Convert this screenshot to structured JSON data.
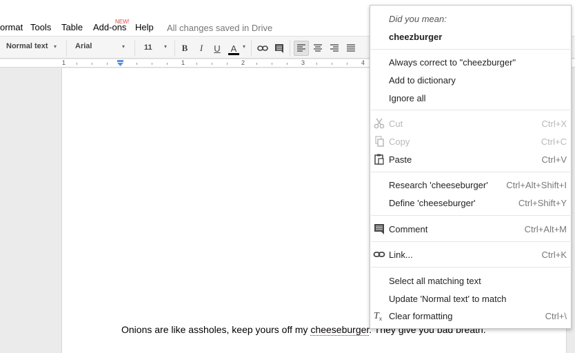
{
  "menubar": {
    "items": [
      "ormat",
      "Tools",
      "Table",
      "Add-ons",
      "Help"
    ],
    "new_badge": "NEW!",
    "status": "All changes saved in Drive"
  },
  "toolbar": {
    "style_select": "Normal text",
    "font_select": "Arial",
    "size_select": "11",
    "bold": "B",
    "italic": "I",
    "underline": "U",
    "text_color": "A",
    "icons": [
      "link-icon",
      "comment-icon",
      "align-left-icon",
      "align-center-icon",
      "align-right-icon",
      "align-justify-icon"
    ],
    "text_color_value": "#000000"
  },
  "ruler": {
    "numbers": [
      "1",
      "1",
      "2",
      "3",
      "4"
    ]
  },
  "document": {
    "before": "Onions are like assholes, keep yours off my ",
    "misspelled": "cheeseburger",
    "after": ". They give you bad breath."
  },
  "context_menu": {
    "did_you_mean": "Did you mean:",
    "suggestion": "cheezburger",
    "items": [
      {
        "label": "Always correct to \"cheezburger\"",
        "shortcut": "",
        "icon": ""
      },
      {
        "label": "Add to dictionary",
        "shortcut": "",
        "icon": ""
      },
      {
        "label": "Ignore all",
        "shortcut": "",
        "icon": ""
      },
      {
        "label": "Cut",
        "shortcut": "Ctrl+X",
        "icon": "scissors-icon",
        "disabled": true
      },
      {
        "label": "Copy",
        "shortcut": "Ctrl+C",
        "icon": "copy-icon",
        "disabled": true
      },
      {
        "label": "Paste",
        "shortcut": "Ctrl+V",
        "icon": "paste-icon"
      },
      {
        "label": "Research 'cheeseburger'",
        "shortcut": "Ctrl+Alt+Shift+I",
        "icon": ""
      },
      {
        "label": "Define 'cheeseburger'",
        "shortcut": "Ctrl+Shift+Y",
        "icon": ""
      },
      {
        "label": "Comment",
        "shortcut": "Ctrl+Alt+M",
        "icon": "comment-icon"
      },
      {
        "label": "Link...",
        "shortcut": "Ctrl+K",
        "icon": "link-icon"
      },
      {
        "label": "Select all matching text",
        "shortcut": "",
        "icon": ""
      },
      {
        "label": "Update 'Normal text' to match",
        "shortcut": "",
        "icon": ""
      },
      {
        "label": "Clear formatting",
        "shortcut": "Ctrl+\\",
        "icon": "clear-formatting-icon"
      }
    ]
  }
}
